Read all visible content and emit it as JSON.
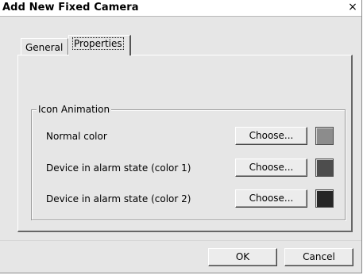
{
  "window": {
    "title": "Add New Fixed Camera",
    "close_glyph": "×"
  },
  "tabs": [
    {
      "label": "General",
      "selected": false
    },
    {
      "label": "Properties",
      "selected": true
    }
  ],
  "group": {
    "label": "Icon Animation",
    "rows": [
      {
        "label": "Normal color",
        "button": "Choose...",
        "color": "#8c8c8c"
      },
      {
        "label": "Device in alarm state (color 1)",
        "button": "Choose...",
        "color": "#4d4d4d"
      },
      {
        "label": "Device in alarm state (color 2)",
        "button": "Choose...",
        "color": "#262626"
      }
    ]
  },
  "footer": {
    "ok_label": "OK",
    "cancel_label": "Cancel"
  },
  "icons": {
    "close": "close-icon"
  }
}
